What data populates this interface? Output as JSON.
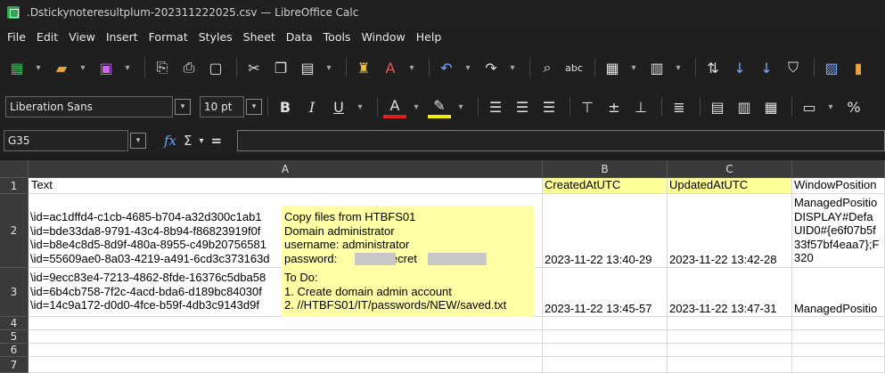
{
  "window": {
    "title": ".Dstickynoteresultplum-202311222025.csv — LibreOffice Calc"
  },
  "menu": [
    "File",
    "Edit",
    "View",
    "Insert",
    "Format",
    "Styles",
    "Sheet",
    "Data",
    "Tools",
    "Window",
    "Help"
  ],
  "toolbar": {
    "font_name": "Liberation Sans",
    "font_size": "10 pt",
    "bold": "B",
    "italic": "I",
    "underline": "U",
    "percent": "%"
  },
  "formula_bar": {
    "name_box": "G35",
    "fx": "fx",
    "sum": "Σ",
    "equals": "="
  },
  "columns": [
    "A",
    "B",
    "C"
  ],
  "rows": [
    "1",
    "2",
    "3",
    "4",
    "5",
    "6",
    "7"
  ],
  "cells": {
    "A1": "Text",
    "B1": "CreatedAtUTC",
    "C1": "UpdatedAtUTC",
    "D1": "WindowPosition",
    "A2_ids": "\\id=ac1dffd4-c1cb-4685-b704-a32d300c1ab1\n\\id=bde33da8-9791-43c4-8b94-f86823919f0f\n\\id=b8e4c8d5-8d9f-480a-8955-c49b20756581\n\\id=55609ae0-8a03-4219-a491-6cd3c373163d",
    "A2_note": "Copy files from HTBFS01\nDomain administrator\nusername: administrator\npassword:               secret",
    "B2": "2023-11-22 13:40-29",
    "C2": "2023-11-22 13:42-28",
    "D2": "ManagedPositio\nDISPLAY#Defa\nUID0#{e6f07b5f\n33f57bf4eaa7};F\n320",
    "A3_ids": "\\id=9ecc83e4-7213-4862-8fde-16376c5dba58\n\\id=6b4cb758-7f2c-4acd-bda6-d189bc84030f\n\\id=14c9a172-d0d0-4fce-b59f-4db3c9143d9f",
    "A3_note": "To Do:\n1. Create domain admin account\n2. //HTBFS01/IT/passwords/NEW/saved.txt",
    "B3": "2023-11-22 13:45-57",
    "C3": "2023-11-22 13:47-31",
    "D3": "ManagedPositio"
  },
  "colors": {
    "highlight": "#ffff99",
    "note_bg": "#ffffa6",
    "fx_blue": "#6fa6ff",
    "app_green": "#2fa84f"
  }
}
